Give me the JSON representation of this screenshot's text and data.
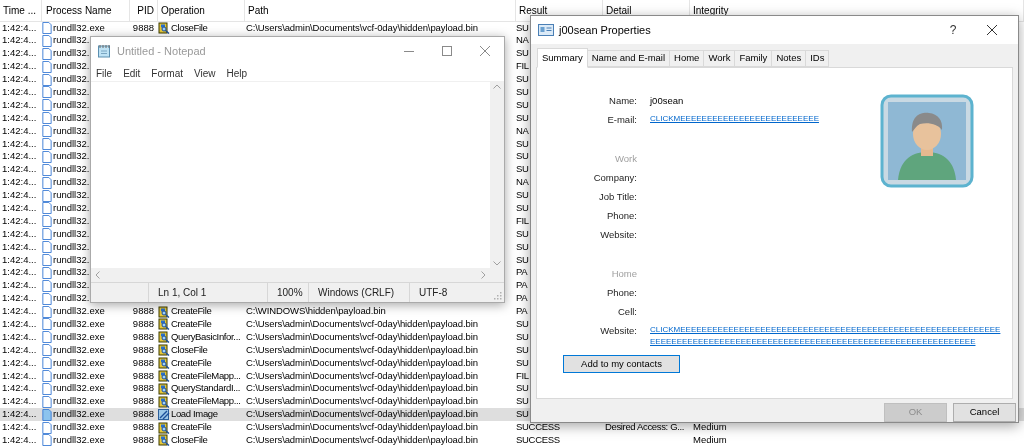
{
  "process_monitor": {
    "columns": [
      "Time ...",
      "Process Name",
      "PID",
      "Operation",
      "Path",
      "Result",
      "Detail",
      "Integrity"
    ],
    "rows": [
      {
        "time": "1:42:4...",
        "process": "rundll32.exe",
        "pid": "9888",
        "operation": "CloseFile",
        "kind": "file",
        "path": "C:\\Users\\admin\\Documents\\vcf-0day\\hidden\\payload.bin",
        "result": "SU",
        "selected": false
      },
      {
        "time": "1:42:4...",
        "process": "rundll32.",
        "result": "NA",
        "selected": false
      },
      {
        "time": "1:42:4...",
        "process": "rundll32.",
        "result": "SU",
        "selected": false
      },
      {
        "time": "1:42:4...",
        "process": "rundll32.",
        "result": "FIL",
        "selected": false
      },
      {
        "time": "1:42:4...",
        "process": "rundll32.",
        "result": "SU",
        "selected": false
      },
      {
        "time": "1:42:4...",
        "process": "rundll32.",
        "result": "SU",
        "selected": false
      },
      {
        "time": "1:42:4...",
        "process": "rundll32.",
        "result": "SU",
        "selected": false
      },
      {
        "time": "1:42:4...",
        "process": "rundll32.",
        "result": "SU",
        "selected": false
      },
      {
        "time": "1:42:4...",
        "process": "rundll32.",
        "result": "NA",
        "selected": false
      },
      {
        "time": "1:42:4...",
        "process": "rundll32.",
        "result": "SU",
        "selected": false
      },
      {
        "time": "1:42:4...",
        "process": "rundll32.",
        "result": "SU",
        "selected": false
      },
      {
        "time": "1:42:4...",
        "process": "rundll32.",
        "result": "SU",
        "selected": false
      },
      {
        "time": "1:42:4...",
        "process": "rundll32.",
        "result": "NA",
        "selected": false
      },
      {
        "time": "1:42:4...",
        "process": "rundll32.",
        "result": "SU",
        "selected": false
      },
      {
        "time": "1:42:4...",
        "process": "rundll32.",
        "result": "SU",
        "selected": false
      },
      {
        "time": "1:42:4...",
        "process": "rundll32.",
        "result": "FIL",
        "selected": false
      },
      {
        "time": "1:42:4...",
        "process": "rundll32.",
        "result": "SU",
        "selected": false
      },
      {
        "time": "1:42:4...",
        "process": "rundll32.",
        "result": "SU",
        "selected": false
      },
      {
        "time": "1:42:4...",
        "process": "rundll32.",
        "result": "SU",
        "selected": false
      },
      {
        "time": "1:42:4...",
        "process": "rundll32.",
        "result": "PA",
        "selected": false
      },
      {
        "time": "1:42:4...",
        "process": "rundll32.",
        "result": "PA",
        "selected": false
      },
      {
        "time": "1:42:4...",
        "process": "rundll32.",
        "result": "PA",
        "selected": false
      },
      {
        "time": "1:42:4...",
        "process": "rundll32.exe",
        "pid": "9888",
        "operation": "CreateFile",
        "kind": "file",
        "path": "C:\\WINDOWS\\hidden\\payload.bin",
        "result": "PA",
        "selected": false
      },
      {
        "time": "1:42:4...",
        "process": "rundll32.exe",
        "pid": "9888",
        "operation": "CreateFile",
        "kind": "file",
        "path": "C:\\Users\\admin\\Documents\\vcf-0day\\hidden\\payload.bin",
        "result": "SU",
        "selected": false
      },
      {
        "time": "1:42:4...",
        "process": "rundll32.exe",
        "pid": "9888",
        "operation": "QueryBasicInfor...",
        "kind": "file",
        "path": "C:\\Users\\admin\\Documents\\vcf-0day\\hidden\\payload.bin",
        "result": "SU",
        "selected": false
      },
      {
        "time": "1:42:4...",
        "process": "rundll32.exe",
        "pid": "9888",
        "operation": "CloseFile",
        "kind": "file",
        "path": "C:\\Users\\admin\\Documents\\vcf-0day\\hidden\\payload.bin",
        "result": "SU",
        "selected": false
      },
      {
        "time": "1:42:4...",
        "process": "rundll32.exe",
        "pid": "9888",
        "operation": "CreateFile",
        "kind": "file",
        "path": "C:\\Users\\admin\\Documents\\vcf-0day\\hidden\\payload.bin",
        "result": "SU",
        "selected": false
      },
      {
        "time": "1:42:4...",
        "process": "rundll32.exe",
        "pid": "9888",
        "operation": "CreateFileMapp...",
        "kind": "file",
        "path": "C:\\Users\\admin\\Documents\\vcf-0day\\hidden\\payload.bin",
        "result": "FIL",
        "selected": false
      },
      {
        "time": "1:42:4...",
        "process": "rundll32.exe",
        "pid": "9888",
        "operation": "QueryStandardI...",
        "kind": "file",
        "path": "C:\\Users\\admin\\Documents\\vcf-0day\\hidden\\payload.bin",
        "result": "SU",
        "selected": false
      },
      {
        "time": "1:42:4...",
        "process": "rundll32.exe",
        "pid": "9888",
        "operation": "CreateFileMapp...",
        "kind": "file",
        "path": "C:\\Users\\admin\\Documents\\vcf-0day\\hidden\\payload.bin",
        "result": "SU",
        "selected": false
      },
      {
        "time": "1:42:4...",
        "process": "rundll32.exe",
        "pid": "9888",
        "operation": "Load Image",
        "kind": "image",
        "path": "C:\\Users\\admin\\Documents\\vcf-0day\\hidden\\payload.bin",
        "result": "SU",
        "selected": true
      },
      {
        "time": "1:42:4...",
        "process": "rundll32.exe",
        "pid": "9888",
        "operation": "CreateFile",
        "kind": "file",
        "path": "C:\\Users\\admin\\Documents\\vcf-0day\\hidden\\payload.bin",
        "result": "SUCCESS",
        "detail": "Desired Access: G...",
        "integrity": "Medium",
        "selected": false
      },
      {
        "time": "1:42:4...",
        "process": "rundll32.exe",
        "pid": "9888",
        "operation": "CloseFile",
        "kind": "file",
        "path": "C:\\Users\\admin\\Documents\\vcf-0day\\hidden\\payload.bin",
        "result": "SUCCESS",
        "integrity": "Medium",
        "selected": false
      }
    ]
  },
  "notepad": {
    "title": "Untitled - Notepad",
    "menu": [
      "File",
      "Edit",
      "Format",
      "View",
      "Help"
    ],
    "status": [
      "Ln 1, Col 1",
      "100%",
      "Windows (CRLF)",
      "UTF-8"
    ]
  },
  "properties": {
    "title": "j00sean Properties",
    "help": "?",
    "tabs": [
      {
        "label": "Summary",
        "selected": true
      },
      {
        "label": "Name and E-mail",
        "selected": false
      },
      {
        "label": "Home",
        "selected": false
      },
      {
        "label": "Work",
        "selected": false
      },
      {
        "label": "Family",
        "selected": false
      },
      {
        "label": "Notes",
        "selected": false
      },
      {
        "label": "IDs",
        "selected": false
      }
    ],
    "fields": [
      {
        "kind": "field",
        "label": "Name:",
        "value": "j00sean"
      },
      {
        "kind": "link",
        "label": "E-mail:",
        "value": "CLICKMEEEEEEEEEEEEEEEEEEEEEEEEEE"
      },
      {
        "kind": "section",
        "label": "Work"
      },
      {
        "kind": "field",
        "label": "Company:"
      },
      {
        "kind": "field",
        "label": "Job Title:"
      },
      {
        "kind": "field",
        "label": "Phone:"
      },
      {
        "kind": "field",
        "label": "Website:"
      },
      {
        "kind": "section",
        "label": "Home"
      },
      {
        "kind": "field",
        "label": "Phone:"
      },
      {
        "kind": "field",
        "label": "Cell:"
      },
      {
        "kind": "link",
        "label": "Website:",
        "value": "CLICKMEEEEEEEEEEEEEEEEEEEEEEEEEEEEEEEEEEEEEEEEEEEEEEEEEEEEEEEEEEEEEEEEEEEEEEEEEEEEEEEEEEEEEEEEEEEEEEEEEEEEEEEEEEEEEEEEEEEEEEEEE"
      }
    ],
    "add_button": "Add to my contacts",
    "buttons": [
      {
        "label": "OK",
        "disabled": true
      },
      {
        "label": "Cancel",
        "disabled": false
      }
    ]
  }
}
